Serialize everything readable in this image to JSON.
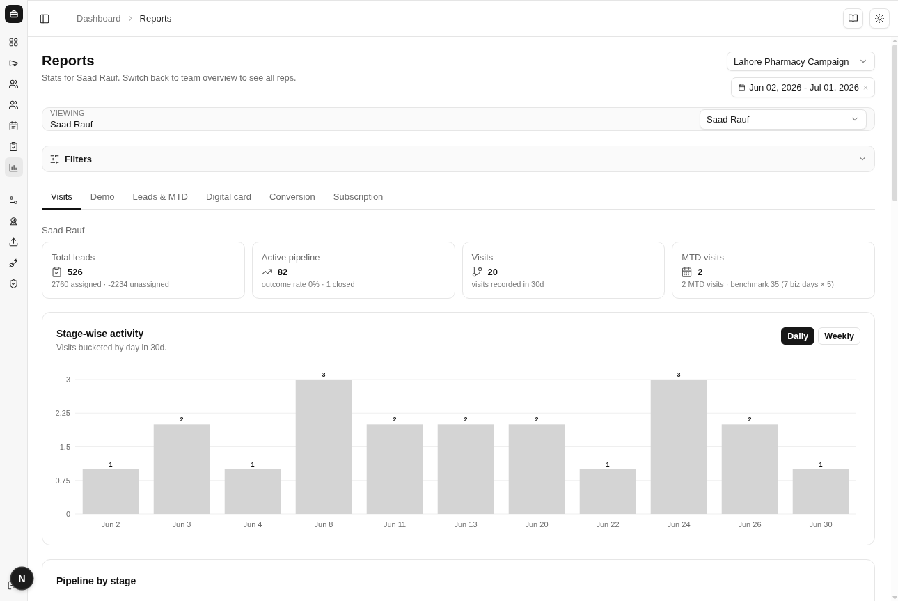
{
  "sidebar": {
    "nav_groups": [
      {
        "items": [
          {
            "selected": false
          },
          {
            "selected": false
          },
          {
            "selected": false
          },
          {
            "selected": false
          },
          {
            "selected": false
          },
          {
            "selected": false
          },
          {
            "selected": true
          }
        ]
      },
      {
        "items": [
          {
            "selected": false
          },
          {
            "selected": false
          },
          {
            "selected": false
          },
          {
            "selected": false
          },
          {
            "selected": false
          }
        ]
      }
    ]
  },
  "topbar": {
    "breadcrumbs": [
      "Dashboard",
      "Reports"
    ]
  },
  "header": {
    "title": "Reports",
    "subtitle": "Stats for Saad Rauf. Switch back to team overview to see all reps.",
    "campaign_select": {
      "value": "Lahore Pharmacy Campaign"
    },
    "date_range": {
      "value": "Jun 02, 2026 - Jul 01, 2026"
    }
  },
  "viewing": {
    "label": "VIEWING",
    "name": "Saad Rauf",
    "rep_select": {
      "value": "Saad Rauf"
    }
  },
  "filters": {
    "label": "Filters",
    "expanded": false
  },
  "tabs": [
    {
      "label": "Visits",
      "selected": true
    },
    {
      "label": "Demo",
      "selected": false
    },
    {
      "label": "Leads & MTD",
      "selected": false
    },
    {
      "label": "Digital card",
      "selected": false
    },
    {
      "label": "Conversion",
      "selected": false
    },
    {
      "label": "Subscription",
      "selected": false
    }
  ],
  "section_label": "Saad Rauf",
  "stat_cards": [
    {
      "label": "Total leads",
      "value": "526",
      "note": "2760 assigned · -2234 unassigned"
    },
    {
      "label": "Active pipeline",
      "value": "82",
      "note": "outcome rate 0% · 1 closed"
    },
    {
      "label": "Visits",
      "value": "20",
      "note": "visits recorded in 30d"
    },
    {
      "label": "MTD visits",
      "value": "2",
      "note": "2 MTD visits · benchmark 35 (7 biz days × 5)"
    }
  ],
  "activity_chart": {
    "title": "Stage-wise activity",
    "subtitle": "Visits bucketed by day in 30d.",
    "toggle": [
      {
        "label": "Daily",
        "selected": true
      },
      {
        "label": "Weekly",
        "selected": false
      }
    ],
    "chart_data": {
      "type": "bar",
      "categories": [
        "Jun 2",
        "Jun 3",
        "Jun 4",
        "Jun 8",
        "Jun 11",
        "Jun 13",
        "Jun 20",
        "Jun 22",
        "Jun 24",
        "Jun 26",
        "Jun 30"
      ],
      "values": [
        1,
        2,
        1,
        3,
        2,
        2,
        2,
        1,
        3,
        2,
        1
      ],
      "ylim": [
        0,
        3
      ],
      "yticks": [
        0,
        0.75,
        1.5,
        2.25,
        3
      ],
      "grid": true,
      "data_labels": true
    }
  },
  "pipeline_card": {
    "title": "Pipeline by stage"
  },
  "dev_badge": {
    "label": "N"
  }
}
